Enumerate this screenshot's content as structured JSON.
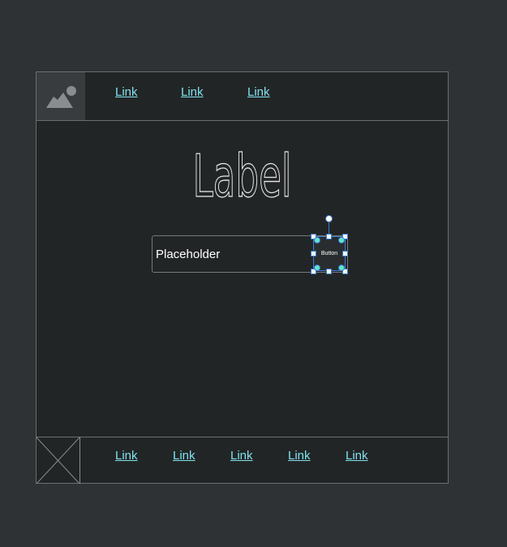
{
  "header": {
    "logo_icon": "image-placeholder-icon",
    "nav_links": [
      "Link",
      "Link",
      "Link"
    ]
  },
  "main": {
    "title": "Label",
    "search": {
      "placeholder": "Placeholder",
      "value": ""
    },
    "button_label": "Button"
  },
  "footer": {
    "image_icon": "image-placeholder-x-icon",
    "links": [
      "Link",
      "Link",
      "Link",
      "Link",
      "Link"
    ]
  },
  "colors": {
    "background": "#2f3234",
    "frame": "#222526",
    "link": "#7de3ef",
    "selection": "#3a7bd5"
  }
}
